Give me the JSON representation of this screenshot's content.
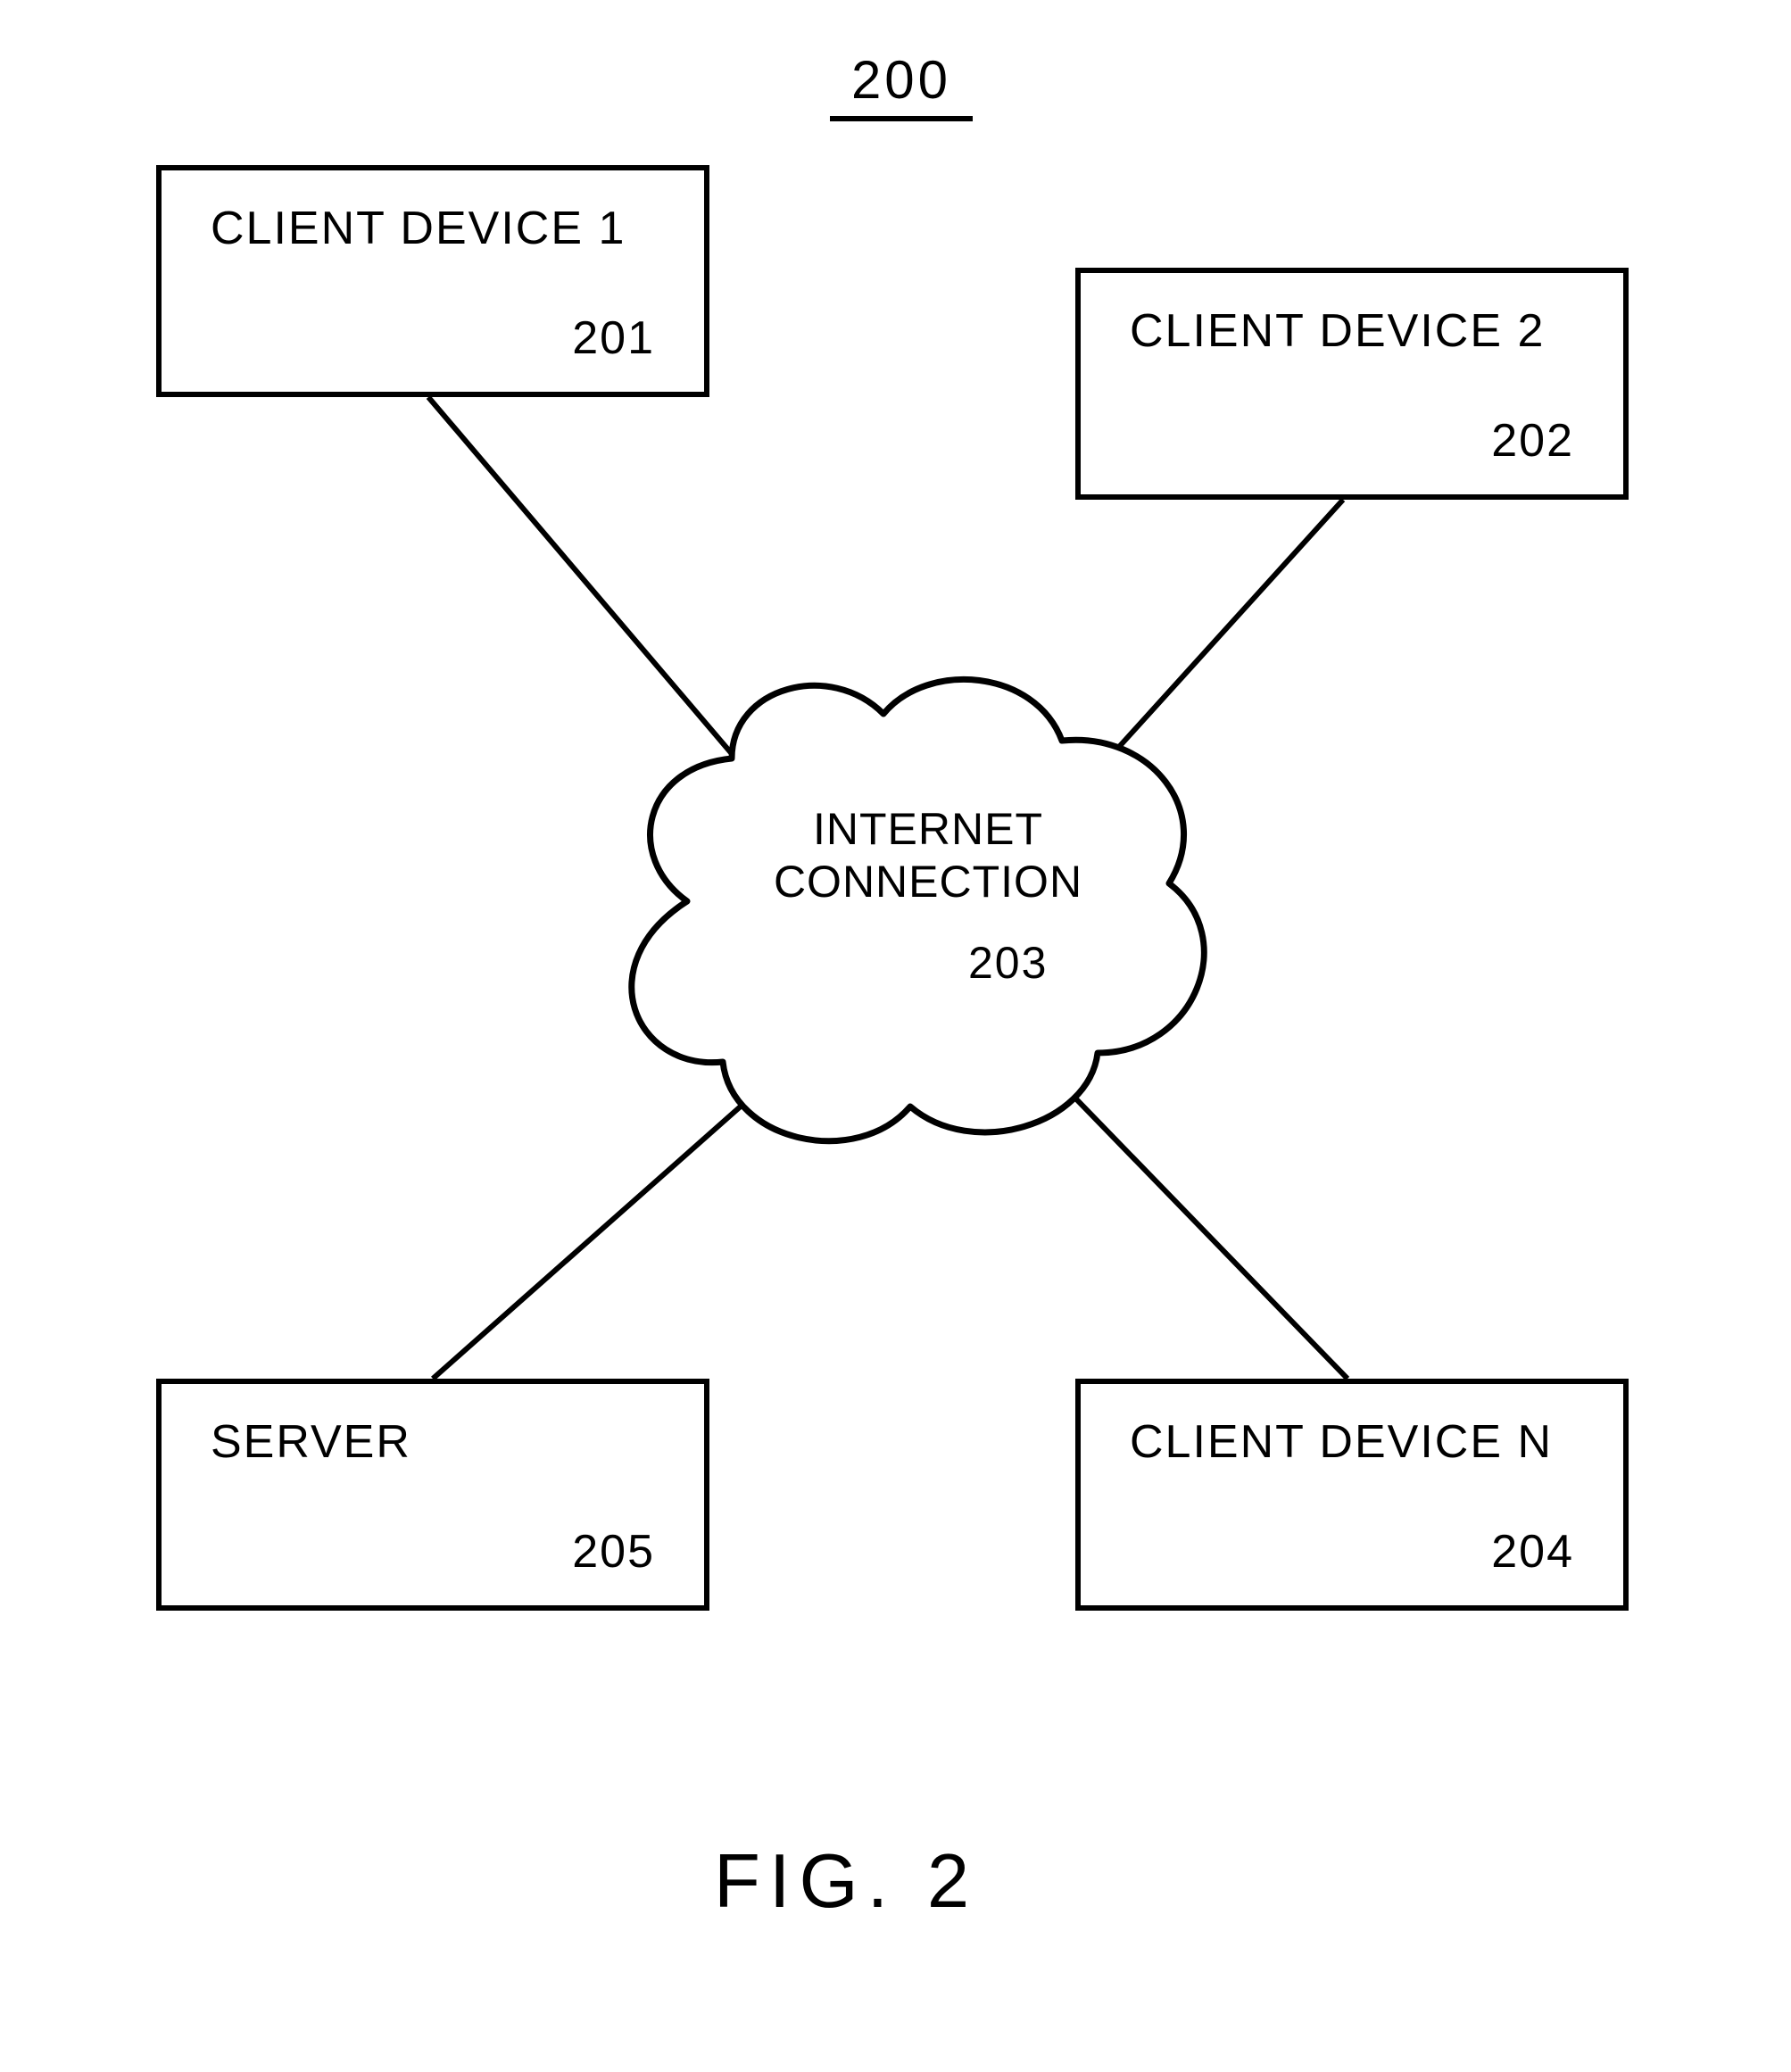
{
  "figure_number_label": "200",
  "nodes": {
    "client1": {
      "label": "CLIENT DEVICE  1",
      "ref": "201"
    },
    "client2": {
      "label": "CLIENT DEVICE  2",
      "ref": "202"
    },
    "cloud": {
      "label_line1": "INTERNET",
      "label_line2": "CONNECTION",
      "ref": "203"
    },
    "clientn": {
      "label": "CLIENT DEVICE  N",
      "ref": "204"
    },
    "server": {
      "label": "SERVER",
      "ref": "205"
    }
  },
  "caption": "FIG.  2"
}
